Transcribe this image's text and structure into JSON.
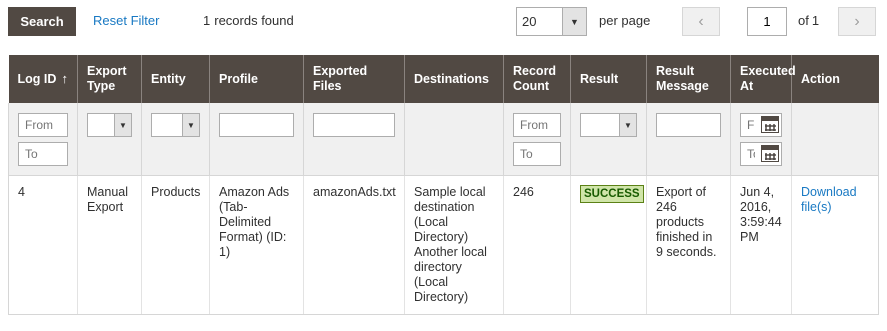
{
  "toolbar": {
    "search_label": "Search",
    "reset_label": "Reset Filter",
    "records_count": "1",
    "records_label": "records found",
    "per_page_value": "20",
    "per_page_label": "per page",
    "current_page": "1",
    "of_label": "of",
    "total_pages": "1",
    "prev_icon": "chevron-left-icon",
    "next_icon": "chevron-right-icon"
  },
  "columns": [
    {
      "label": "Log ID",
      "sorted": "asc"
    },
    {
      "label": "Export Type"
    },
    {
      "label": "Entity"
    },
    {
      "label": "Profile"
    },
    {
      "label": "Exported Files"
    },
    {
      "label": "Destinations"
    },
    {
      "label": "Record Count"
    },
    {
      "label": "Result"
    },
    {
      "label": "Result Message"
    },
    {
      "label": "Executed At"
    },
    {
      "label": "Action"
    }
  ],
  "filters": {
    "log_id_from_placeholder": "From",
    "log_id_to_placeholder": "To",
    "record_count_from_placeholder": "From",
    "record_count_to_placeholder": "To",
    "executed_from_placeholder": "From",
    "executed_to_placeholder": "To"
  },
  "rows": [
    {
      "log_id": "4",
      "export_type": "Manual Export",
      "entity": "Products",
      "profile": "Amazon Ads (Tab-Delimited Format) (ID: 1)",
      "exported_files": "amazonAds.txt",
      "destinations": [
        "Sample local destination (Local Directory)",
        "Another local directory (Local Directory)"
      ],
      "record_count": "246",
      "result": "SUCCESS",
      "result_message": "Export of 246 products finished in 9 seconds.",
      "executed_at": "Jun 4, 2016, 3:59:44 PM",
      "action": "Download file(s)"
    }
  ],
  "colors": {
    "header_bg": "#514943",
    "link": "#1979c3",
    "success_bg": "#d0e5a9",
    "success_border": "#5b8116",
    "success_text": "#185b00"
  }
}
